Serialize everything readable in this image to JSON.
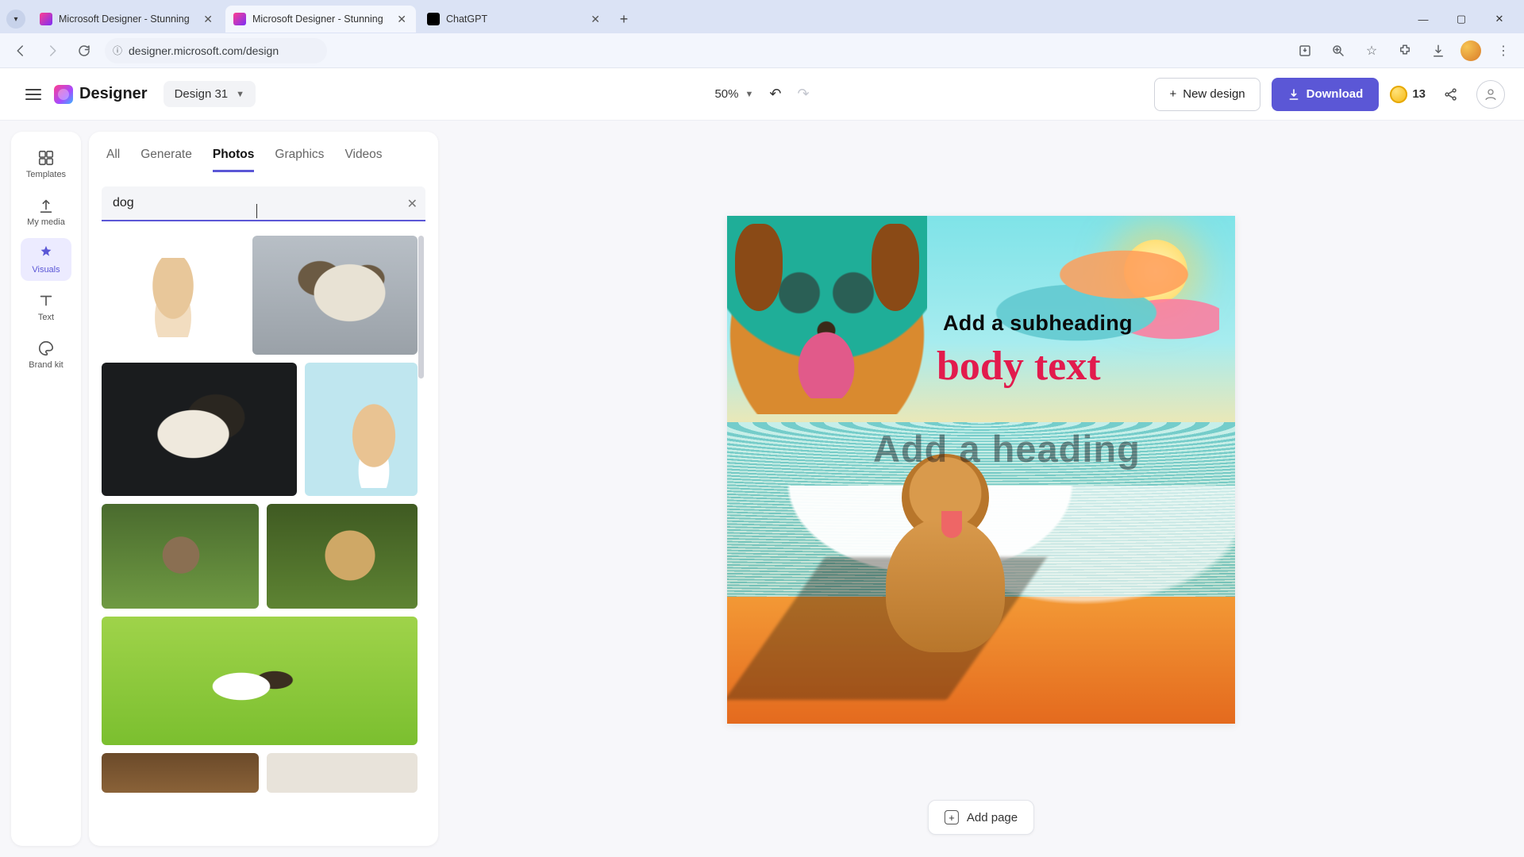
{
  "browser": {
    "tabs": [
      {
        "title": "Microsoft Designer - Stunning",
        "active": false
      },
      {
        "title": "Microsoft Designer - Stunning",
        "active": true
      },
      {
        "title": "ChatGPT",
        "active": false
      }
    ],
    "url": "designer.microsoft.com/design"
  },
  "header": {
    "brand": "Designer",
    "design_name": "Design 31",
    "zoom": "50%",
    "new_design": "New design",
    "download": "Download",
    "credits": "13"
  },
  "rail": {
    "templates": "Templates",
    "my_media": "My media",
    "visuals": "Visuals",
    "text": "Text",
    "brand_kit": "Brand kit"
  },
  "panel": {
    "tabs": {
      "all": "All",
      "generate": "Generate",
      "photos": "Photos",
      "graphics": "Graphics",
      "videos": "Videos"
    },
    "active_tab": "Photos",
    "search_value": "dog"
  },
  "canvas": {
    "subheading": "Add a subheading",
    "bodytext": "body text",
    "heading": "Add a heading"
  },
  "footer": {
    "add_page": "Add page"
  }
}
